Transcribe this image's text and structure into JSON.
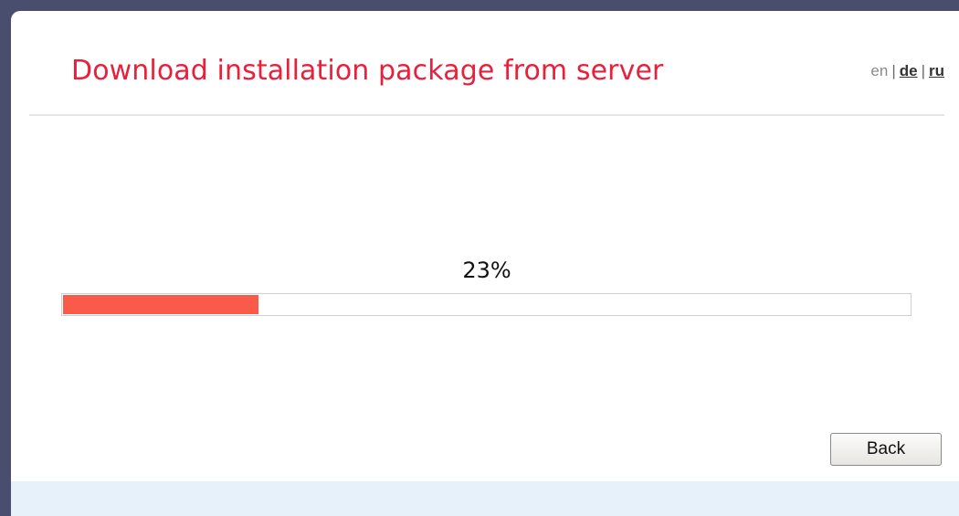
{
  "header": {
    "title": "Download installation package from server",
    "languages": {
      "current": "en",
      "separator": "|",
      "links": [
        "de",
        "ru"
      ]
    }
  },
  "progress": {
    "percent_label": "23%",
    "value": 0.23,
    "fill_color": "#fa5a49"
  },
  "actions": {
    "back_label": "Back"
  },
  "colors": {
    "title": "#e8203c",
    "footer": "#e7f1f9",
    "frame": "#4a4e6e"
  }
}
